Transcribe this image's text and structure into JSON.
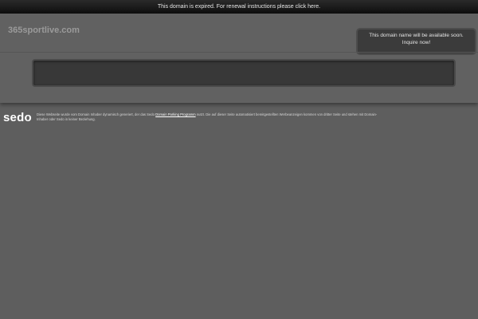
{
  "topbar": {
    "message": "This domain is expired. For renewal instructions please click here."
  },
  "header": {
    "domain": "365sportlive.com",
    "notice_line1": "This domain name will be available soon.",
    "notice_line2": "Inquire now!"
  },
  "footer": {
    "logo": "sedo",
    "disclaimer_before": "Diese Webseite wurde vom Domain Inhaber dynamisch generiert, der das Sedo ",
    "disclaimer_link": "Domain Parking Programm",
    "disclaimer_after": " nutzt. Die auf dieser Seite automatisiert bereitgestellten Werbeanzeigen kommen von dritter Seite und stehen mit Domain-Inhaber oder Sedo in keiner Beziehung."
  },
  "colors": {
    "background": "#5e5e5e",
    "topbar": "#141414",
    "notice_box": "#3b3b3b",
    "search_bar": "#383838"
  }
}
